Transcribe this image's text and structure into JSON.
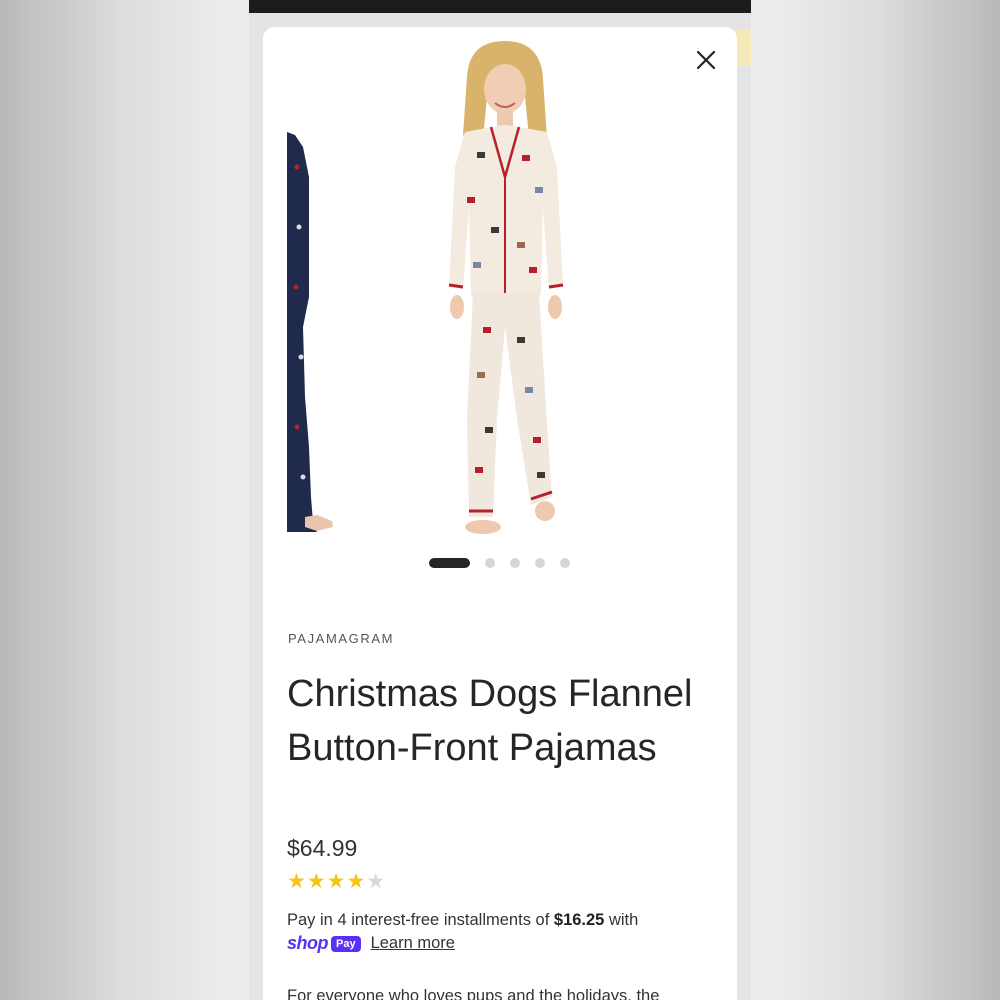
{
  "product": {
    "brand": "PAJAMAGRAM",
    "title": "Christmas Dogs Flannel Button-Front Pajamas",
    "price": "$64.99",
    "rating": 4,
    "rating_max": 5,
    "description_preview": "For everyone who loves pups and the holidays, the"
  },
  "gallery": {
    "slide_count": 5,
    "active_index": 0
  },
  "payment": {
    "installments_prefix": "Pay in 4 interest-free installments of",
    "installment_amount": "$16.25",
    "installments_suffix": "with",
    "shop_word": "shop",
    "pay_badge": "Pay",
    "learn_more": "Learn more"
  },
  "icons": {
    "close": "close-icon",
    "star": "star-icon"
  },
  "colors": {
    "star_filled": "#f5c518",
    "star_empty": "#d9d9d9",
    "shop_pay": "#5a31f4",
    "dot_active": "#262626"
  }
}
